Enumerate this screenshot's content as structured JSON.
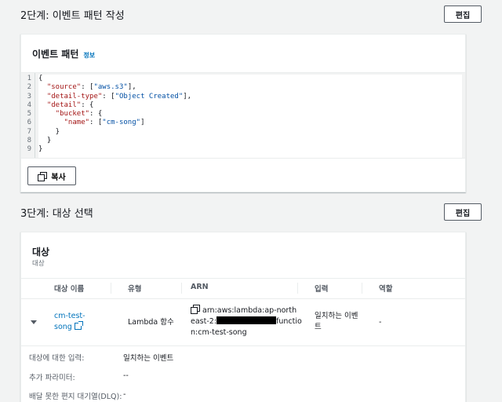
{
  "step2": {
    "title": "2단계: 이벤트 패턴 작성",
    "edit_label": "편집",
    "panel_title": "이벤트 패턴",
    "info_label": "정보",
    "line_numbers": [
      "1",
      "2",
      "3",
      "4",
      "5",
      "6",
      "7",
      "8",
      "9"
    ],
    "code_lines": [
      {
        "pre": "{",
        "key": "",
        "mid": "",
        "val": "",
        "post": ""
      },
      {
        "pre": "  ",
        "key": "\"source\"",
        "mid": ": [",
        "val": "\"aws.s3\"",
        "post": "],"
      },
      {
        "pre": "  ",
        "key": "\"detail-type\"",
        "mid": ": [",
        "val": "\"Object Created\"",
        "post": "],"
      },
      {
        "pre": "  ",
        "key": "\"detail\"",
        "mid": ": {",
        "val": "",
        "post": ""
      },
      {
        "pre": "    ",
        "key": "\"bucket\"",
        "mid": ": {",
        "val": "",
        "post": ""
      },
      {
        "pre": "      ",
        "key": "\"name\"",
        "mid": ": [",
        "val": "\"cm-song\"",
        "post": "]"
      },
      {
        "pre": "    }",
        "key": "",
        "mid": "",
        "val": "",
        "post": ""
      },
      {
        "pre": "  }",
        "key": "",
        "mid": "",
        "val": "",
        "post": ""
      },
      {
        "pre": "}",
        "key": "",
        "mid": "",
        "val": "",
        "post": ""
      }
    ],
    "copy_label": "복사"
  },
  "step3": {
    "title": "3단계: 대상 선택",
    "edit_label": "편집",
    "panel_title": "대상",
    "panel_subtitle": "대상",
    "columns": [
      "대상 이름",
      "유형",
      "ARN",
      "입력",
      "역할"
    ],
    "row": {
      "name_line1": "cm-test-",
      "name_line2": "song",
      "type": "Lambda 함수",
      "arn_line1": "arn:aws:lambda:ap-north",
      "arn_line2a": "east-2:",
      "arn_line2b": "functio",
      "arn_line3": "n:cm-test-song",
      "input_line1": "일치하는 이벤",
      "input_line2": "트",
      "role": "-"
    },
    "details": [
      {
        "label": "대상에 대한 입력:",
        "value": "일치하는 이벤트"
      },
      {
        "label": "추가 파라미터:",
        "value": "--"
      },
      {
        "label": "배달 못한 편지 대기열(DLQ):",
        "value": "-"
      }
    ]
  }
}
